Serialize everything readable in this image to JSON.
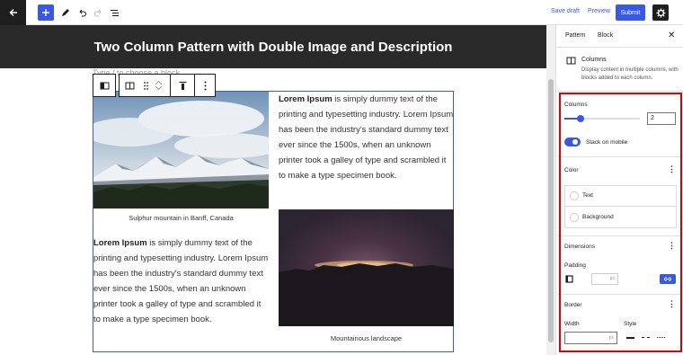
{
  "topbar": {
    "save_draft": "Save draft",
    "preview": "Preview",
    "submit": "Submit",
    "icons": [
      "wordpress-back-icon",
      "plus-icon",
      "pencil-icon",
      "undo-icon",
      "redo-icon",
      "list-view-icon",
      "gear-icon"
    ]
  },
  "canvas": {
    "page_title": "Two Column Pattern with Double Image and Description",
    "placeholder": "Type / to choose a block",
    "left_column": {
      "caption": "Sulphur mountain in Banff, Canada",
      "paragraph_bold": "Lorem Ipsum",
      "paragraph_rest": " is simply dummy text of the printing and typesetting industry. Lorem Ipsum has been the industry's standard dummy text ever since the 1500s, when an unknown printer took a galley of type and scrambled it to make a type specimen book."
    },
    "right_column": {
      "paragraph_bold": "Lorem Ipsum",
      "paragraph_rest": " is simply dummy text of the printing and typesetting industry. Lorem Ipsum has been the industry's standard dummy text ever since the 1500s, when an unknown printer took a galley of type and scrambled it to make a type specimen book.",
      "caption": "Mountainous landscape"
    }
  },
  "sidebar": {
    "tabs": [
      "Pattern",
      "Block"
    ],
    "block": {
      "name": "Columns",
      "description": "Display content in multiple columns, with blocks added to each column."
    },
    "columns_panel": {
      "label": "Columns",
      "value": "2",
      "stack_on_mobile": "Stack on mobile",
      "stack_on_mobile_enabled": true
    },
    "color_panel": {
      "heading": "Color",
      "text": "Text",
      "background": "Background"
    },
    "dimensions_panel": {
      "heading": "Dimensions",
      "padding": "Padding",
      "unit": "px"
    },
    "border_panel": {
      "heading": "Border",
      "width": "Width",
      "style": "Style",
      "unit": "px"
    }
  },
  "colors": {
    "accent": "#3858e9",
    "highlight": "#e00000",
    "title_band": "#2a2a2a"
  }
}
